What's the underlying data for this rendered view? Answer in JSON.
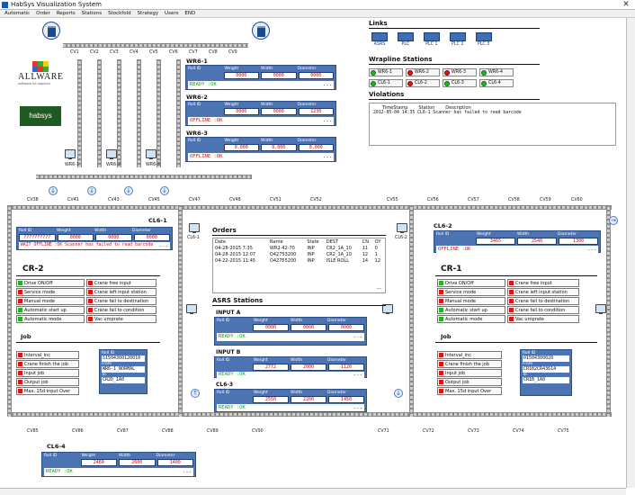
{
  "window": {
    "title": "HabSys Visualization System",
    "close": "✕"
  },
  "menu": [
    "Automatic",
    "Order",
    "Reports",
    "Stations",
    "Stockfold",
    "Strategy",
    "Users",
    "END"
  ],
  "conveyors": {
    "top": [
      "CV1",
      "CV2",
      "CV3",
      "CV4",
      "CV5",
      "CV6",
      "CV7",
      "CV8",
      "CV9"
    ],
    "mid": [
      "CV10",
      "CV20",
      "CV30",
      "CV40",
      "CV50",
      "CV60",
      "CV70",
      "CV80"
    ],
    "loop_top": [
      "CV38",
      "CV41",
      "CV43",
      "CV45",
      "CV47",
      "CV48",
      "CV51",
      "CV52",
      "CV55",
      "CV56",
      "CV57",
      "CV58",
      "CV59",
      "CV60"
    ],
    "loop_bottom": [
      "CV85",
      "CV86",
      "CV87",
      "CV88",
      "CV89",
      "CV90",
      "CV71",
      "CV72",
      "CV73",
      "CV74",
      "CV75"
    ],
    "left_v": [
      "CV15",
      "CV16",
      "CV17",
      "CV18",
      "CV19",
      "CV20",
      "CV21",
      "CV22"
    ],
    "right_v": [
      "CV62",
      "CV63",
      "CV64",
      "CV65",
      "CV66",
      "CV67",
      "CV68",
      "CV69"
    ]
  },
  "logos": {
    "allware": "ALLWARE",
    "allware_sub": "software for logistics",
    "habsys": "habsys"
  },
  "monitors": [
    "WR6-1",
    "WR6-2",
    "WR6-3",
    "CL6-1",
    "CL6-2",
    "CL6-3"
  ],
  "wr6_panels": [
    {
      "name": "WR6-1",
      "headers": [
        "Roll ID",
        "Weight",
        "Width",
        "Diameter"
      ],
      "values": [
        "0000",
        "0000",
        "0000"
      ],
      "status": "READY   :OK",
      "status_kind": "ok"
    },
    {
      "name": "WR6-2",
      "headers": [
        "Roll ID",
        "Weight",
        "Width",
        "Diameter"
      ],
      "values": [
        "0000",
        "0000",
        "1230"
      ],
      "status": "OFFLINE :OK",
      "status_kind": "err"
    },
    {
      "name": "WR6-3",
      "headers": [
        "Roll ID",
        "Weight",
        "Width",
        "Diameter"
      ],
      "values": [
        "0.000",
        "0.000",
        "0.000"
      ],
      "status": "OFFLINE :OK",
      "status_kind": "err"
    }
  ],
  "links": {
    "title": "Links",
    "items": [
      "ASRS",
      "PLC",
      "PLC 1",
      "PLC 2",
      "PLC 3"
    ]
  },
  "wrapline": {
    "title": "Wrapline Stations",
    "row1": [
      {
        "label": "WR6-1",
        "s": "green"
      },
      {
        "label": "WR6-2",
        "s": "red"
      },
      {
        "label": "WR6-3",
        "s": "red"
      },
      {
        "label": "WR6-4",
        "s": "green"
      }
    ],
    "row2": [
      {
        "label": "CL6-1",
        "s": "green"
      },
      {
        "label": "CL6-2",
        "s": "red"
      },
      {
        "label": "CL6-3",
        "s": "green"
      },
      {
        "label": "CL6-4",
        "s": "green"
      }
    ]
  },
  "violations": {
    "title": "Violations",
    "headers": [
      "TimeStamp",
      "Station",
      "Description"
    ],
    "row": "2012-05-04 14:35  CL6-1    Scanner has failed to read barcode"
  },
  "cl6_1": {
    "name": "CL6-1",
    "headers": [
      "Roll ID",
      "Weight",
      "Width",
      "Diameter"
    ],
    "roll": "??????????",
    "values": [
      "0000",
      "0000",
      "0000"
    ],
    "status": "WAIT OFFLINE :OK Scanner has failed to read barcode",
    "more": "..."
  },
  "cl6_2": {
    "name": "CL6-2",
    "headers": [
      "Roll ID",
      "Weight",
      "Width",
      "Diameter"
    ],
    "values": [
      "3465",
      "2540",
      "1300"
    ],
    "status": "OFFLINE :OK",
    "more": "..."
  },
  "orders": {
    "title": "Orders",
    "headers": [
      "Date",
      "Name",
      "State",
      "DEST",
      "CN",
      "OY"
    ],
    "rows": [
      [
        "04-28-2015  7:35",
        "WR2-42-70",
        "INP",
        "CR2_1A_10",
        "11",
        "0"
      ],
      [
        "04-28-2015 12:07",
        "O42753200",
        "INP",
        "CR2_1A_10",
        "12",
        "1"
      ],
      [
        "04-22-2015 11:45",
        "O42755200",
        "INP",
        "ISLE ROLL",
        "14",
        "12"
      ]
    ],
    "more": "..."
  },
  "asrs": {
    "title": "ASRS Stations",
    "stations": [
      {
        "name": "INPUT A",
        "headers": [
          "Roll ID",
          "Weight",
          "Width",
          "Diameter"
        ],
        "values": [
          "0000",
          "0000",
          "0000"
        ],
        "status": "READY    :OK"
      },
      {
        "name": "INPUT B",
        "headers": [
          "Roll ID",
          "Weight",
          "Width",
          "Diameter"
        ],
        "values": [
          "2772",
          "2000",
          "1120"
        ],
        "status": "READY    :OK"
      },
      {
        "name": "CL6-3",
        "headers": [
          "Roll ID",
          "Weight",
          "Width",
          "Diameter"
        ],
        "values": [
          "2550",
          "2200",
          "1450"
        ],
        "status": "READY    :OK"
      }
    ]
  },
  "cl6_4": {
    "name": "CL6-4",
    "headers": [
      "Roll ID",
      "Weight",
      "Width",
      "Diameter"
    ],
    "values": [
      "2460",
      "2600",
      "1400"
    ],
    "status": "READY    :OK",
    "more": "..."
  },
  "cr2": {
    "title": "CR-2",
    "left": [
      {
        "label": "Drive ON/Off",
        "s": "green"
      },
      {
        "label": "Service mode",
        "s": "red"
      },
      {
        "label": "Manual mode",
        "s": "red"
      },
      {
        "label": "Automatic start up",
        "s": "green"
      },
      {
        "label": "Automatic mode",
        "s": "green"
      }
    ],
    "right": [
      {
        "label": "Crane free input",
        "s": "red"
      },
      {
        "label": "Crane left input station",
        "s": "red"
      },
      {
        "label": "Crane fail to destination",
        "s": "red"
      },
      {
        "label": "Crane fail to condition",
        "s": "red"
      },
      {
        "label": "Vac umprate",
        "s": "red"
      }
    ],
    "job_title": "Job",
    "job": [
      {
        "label": "Interval_inc",
        "s": "red"
      },
      {
        "label": "Crane finish the job",
        "s": "red"
      },
      {
        "label": "Input job",
        "s": "red"
      },
      {
        "label": "Output job",
        "s": "red"
      },
      {
        "label": "Max. 15d input Over",
        "s": "red"
      }
    ],
    "jobinfo": {
      "roll_k": "Roll ID",
      "roll_v": "S1504300120010",
      "from_k": "From",
      "from_v": "WR6-1_NORMAL",
      "to_k": "To",
      "to_v": "CR2D_1A0"
    }
  },
  "cr1": {
    "title": "CR-1",
    "left": [
      {
        "label": "Drive ON/Off",
        "s": "green"
      },
      {
        "label": "Service mode",
        "s": "red"
      },
      {
        "label": "Manual mode",
        "s": "red"
      },
      {
        "label": "Automatic start up",
        "s": "green"
      },
      {
        "label": "Automatic mode",
        "s": "green"
      }
    ],
    "right": [
      {
        "label": "Crane free input",
        "s": "red"
      },
      {
        "label": "Crane left input station",
        "s": "red"
      },
      {
        "label": "Crane fail to destination",
        "s": "red"
      },
      {
        "label": "Crane fail to condition",
        "s": "red"
      },
      {
        "label": "Vac umprate",
        "s": "red"
      }
    ],
    "job_title": "Job",
    "job": [
      {
        "label": "Interval_inc",
        "s": "red"
      },
      {
        "label": "Crane finish the job",
        "s": "red"
      },
      {
        "label": "Input job",
        "s": "red"
      },
      {
        "label": "Output job",
        "s": "red"
      },
      {
        "label": "Max. 15d input Over",
        "s": "red"
      }
    ],
    "jobinfo": {
      "roll_k": "Roll ID",
      "roll_v": "01504300020",
      "from_k": "From",
      "from_v": "CR1B2CR43614",
      "to_k": "To",
      "to_v": "CR1B_1A0"
    }
  }
}
